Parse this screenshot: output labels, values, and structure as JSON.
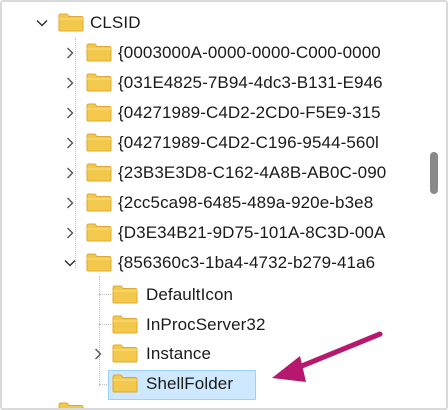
{
  "tree": {
    "root": {
      "label": "CLSID",
      "expanded": true
    },
    "children": [
      {
        "label": "{0003000A-0000-0000-C000-0000"
      },
      {
        "label": "{031E4825-7B94-4dc3-B131-E946"
      },
      {
        "label": "{04271989-C4D2-2CD0-F5E9-315"
      },
      {
        "label": "{04271989-C4D2-C196-9544-560l"
      },
      {
        "label": "{23B3E3D8-C162-4A8B-AB0C-090"
      },
      {
        "label": "{2cc5ca98-6485-489a-920e-b3e8"
      },
      {
        "label": "{D3E34B21-9D75-101A-8C3D-00A"
      },
      {
        "label": "{856360c3-1ba4-4732-b279-41a6"
      }
    ],
    "subchildren": [
      {
        "label": "DefaultIcon"
      },
      {
        "label": "InProcServer32"
      },
      {
        "label": "Instance"
      },
      {
        "label": "ShellFolder"
      }
    ],
    "bottom_partial": {
      "label": "..."
    }
  },
  "colors": {
    "folder": "#f2c94c",
    "selection": "#cde8ff",
    "arrow": "#b5186d"
  },
  "icons": {
    "chevron_right": "chevron-right-icon",
    "chevron_down": "chevron-down-icon",
    "folder": "folder-icon"
  }
}
